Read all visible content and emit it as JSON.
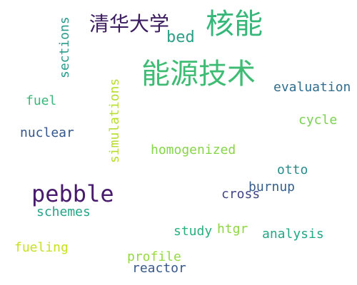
{
  "words": [
    {
      "text": "清华大学",
      "color": "#3b1c5f"
    },
    {
      "text": "核能",
      "color": "#35b779"
    },
    {
      "text": "bed",
      "color": "#2c9f88"
    },
    {
      "text": "能源技术",
      "color": "#3fbc73"
    },
    {
      "text": "sections",
      "color": "#2a9a8b"
    },
    {
      "text": "evaluation",
      "color": "#2f6c8e"
    },
    {
      "text": "fuel",
      "color": "#3bb77a"
    },
    {
      "text": "simulations",
      "color": "#b6de2b"
    },
    {
      "text": "cycle",
      "color": "#7ad151"
    },
    {
      "text": "nuclear",
      "color": "#34568b"
    },
    {
      "text": "homogenized",
      "color": "#86d549"
    },
    {
      "text": "otto",
      "color": "#2a8a8c"
    },
    {
      "text": "pebble",
      "color": "#481a6c"
    },
    {
      "text": "burnup",
      "color": "#355e8d"
    },
    {
      "text": "cross",
      "color": "#414487"
    },
    {
      "text": "schemes",
      "color": "#26a488"
    },
    {
      "text": "htgr",
      "color": "#8ed645"
    },
    {
      "text": "study",
      "color": "#29af7f"
    },
    {
      "text": "analysis",
      "color": "#22a785"
    },
    {
      "text": "fueling",
      "color": "#c8e020"
    },
    {
      "text": "profile",
      "color": "#95d840"
    },
    {
      "text": "reactor",
      "color": "#38588c"
    }
  ]
}
